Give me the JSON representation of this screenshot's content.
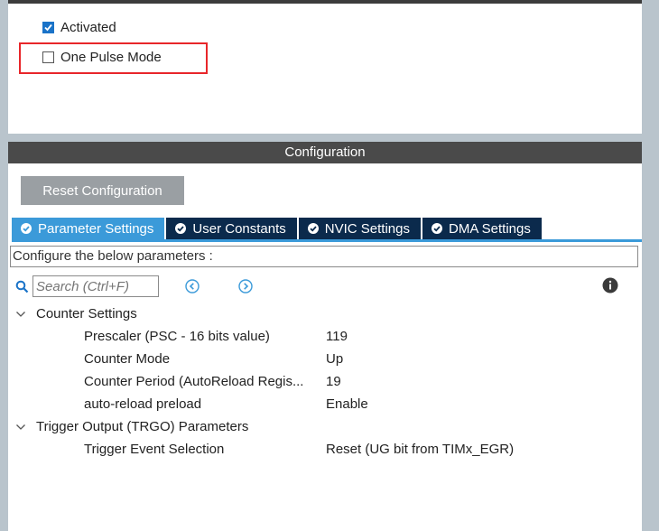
{
  "mode_panel": {
    "activated_label": "Activated",
    "activated_checked": true,
    "one_pulse_label": "One Pulse Mode",
    "one_pulse_checked": false
  },
  "configuration": {
    "header": "Configuration",
    "reset_button": "Reset Configuration",
    "tabs": [
      {
        "label": "Parameter Settings",
        "active": true
      },
      {
        "label": "User Constants",
        "active": false
      },
      {
        "label": "NVIC Settings",
        "active": false
      },
      {
        "label": "DMA Settings",
        "active": false
      }
    ],
    "description": "Configure the below parameters :",
    "search": {
      "placeholder": "Search (Ctrl+F)",
      "value": ""
    },
    "groups": [
      {
        "label": "Counter Settings",
        "expanded": true,
        "params": [
          {
            "name": "Prescaler (PSC - 16 bits value)",
            "value": "119"
          },
          {
            "name": "Counter Mode",
            "value": "Up"
          },
          {
            "name": "Counter Period (AutoReload Regis...",
            "value": "19"
          },
          {
            "name": "auto-reload preload",
            "value": "Enable"
          }
        ]
      },
      {
        "label": "Trigger Output (TRGO) Parameters",
        "expanded": true,
        "params": [
          {
            "name": "Trigger Event Selection",
            "value": "Reset (UG bit from TIMx_EGR)"
          }
        ]
      }
    ]
  },
  "colors": {
    "accent": "#3b9ad9",
    "tab_inactive": "#0b2a4c",
    "highlight_box": "#e8262a",
    "checkbox_checked": "#1a73c8"
  }
}
